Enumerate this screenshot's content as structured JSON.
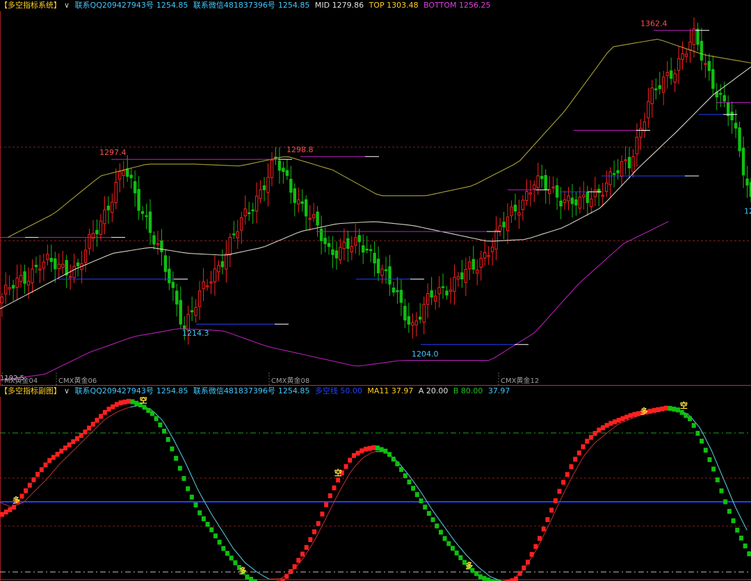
{
  "main": {
    "header": {
      "title": "【多空指标系统】",
      "dropdown": "∨",
      "qq": "联系QQ209427943号",
      "qq_value": "1254.85",
      "wechat": "联系微信481837396号",
      "wechat_value": "1254.85",
      "mid": "MID 1279.86",
      "top": "TOP 1303.48",
      "bottom": "BOTTOM 1256.25"
    },
    "price_labels": {
      "high1": "1297.4",
      "high2": "1298.8",
      "high3": "1362.4",
      "low1": "1214.3",
      "low2": "1204.0",
      "left_cut": "1192.5",
      "right_cut": "12"
    },
    "contract_labels": [
      "MX黄金04",
      "CMX黄金06",
      "CMX黄金08",
      "CMX黄金12"
    ]
  },
  "sub": {
    "header": {
      "title": "【多空指标副图】",
      "dropdown": "∨",
      "qq": "联系QQ209427943号",
      "qq_value": "1254.85",
      "wechat": "联系微信481837396号",
      "wechat_value": "1254.85",
      "line_label": "多空线 50.00",
      "ma": "MA11 37.97",
      "a": "A 20.00",
      "b": "B 80.00",
      "last": "37.97"
    },
    "signals": [
      {
        "text": "多",
        "x": 4
      },
      {
        "text": "空",
        "x": 36
      },
      {
        "text": "多",
        "x": 61
      },
      {
        "text": "空",
        "x": 85
      },
      {
        "text": "多",
        "x": 118
      },
      {
        "text": "多",
        "x": 162
      },
      {
        "text": "空",
        "x": 172
      }
    ]
  },
  "colors": {
    "up": "#ff2020",
    "down": "#10c010",
    "mid": "#e0e0d0",
    "top": "#c8c040",
    "bottom": "#c020c0",
    "ref_blue": "#2040ff",
    "header_cyan": "#40c8ff",
    "header_yellow": "#ffd020"
  },
  "chart_data": [
    {
      "type": "candlestick",
      "price_range": [
        1185,
        1370
      ],
      "candle_count": 198,
      "pivots": [
        [
          0,
          1228
        ],
        [
          10,
          1245
        ],
        [
          20,
          1242
        ],
        [
          32,
          1292
        ],
        [
          38,
          1268
        ],
        [
          48,
          1214
        ],
        [
          58,
          1248
        ],
        [
          72,
          1296
        ],
        [
          86,
          1252
        ],
        [
          96,
          1254
        ],
        [
          108,
          1214
        ],
        [
          114,
          1230
        ],
        [
          124,
          1242
        ],
        [
          140,
          1286
        ],
        [
          152,
          1274
        ],
        [
          165,
          1296
        ],
        [
          170,
          1326
        ],
        [
          182,
          1358
        ],
        [
          192,
          1316
        ],
        [
          197,
          1278
        ]
      ],
      "series": [
        {
          "name": "MID",
          "values": [
            1222,
            1232,
            1242,
            1250,
            1253,
            1250,
            1249,
            1253,
            1261,
            1265,
            1266,
            1264,
            1260,
            1256,
            1257,
            1263,
            1273,
            1293,
            1311,
            1330,
            1344
          ]
        },
        {
          "name": "TOP",
          "values": [
            1258,
            1270,
            1289,
            1295,
            1295,
            1294,
            1299,
            1292,
            1279,
            1279,
            1284,
            1296,
            1322,
            1354,
            1358,
            1350,
            1346
          ]
        },
        {
          "name": "BOTTOM",
          "values": [
            1186,
            1189,
            1200,
            1208,
            1212,
            1211,
            1203,
            1198,
            1193,
            1196,
            1196,
            1196,
            1210,
            1235,
            1255,
            1266
          ]
        }
      ]
    },
    {
      "type": "line",
      "ylim": [
        0,
        100
      ],
      "reference_lines": [
        20,
        50,
        80
      ],
      "series": [
        {
          "name": "多空线",
          "values": [
            45,
            48,
            55,
            62,
            68,
            72,
            76,
            80,
            85,
            90,
            93,
            94,
            92,
            88,
            80,
            68,
            55,
            45,
            38,
            30,
            24,
            18,
            15,
            14,
            16,
            22,
            30,
            40,
            52,
            62,
            70,
            73,
            74,
            72,
            66,
            58,
            50,
            42,
            34,
            28,
            22,
            18,
            16,
            15,
            17,
            24,
            34,
            46,
            58,
            68,
            76,
            81,
            84,
            86,
            88,
            89,
            90,
            91,
            90,
            86,
            76,
            64,
            50,
            38,
            28
          ]
        },
        {
          "name": "MA11",
          "values": [
            50,
            48,
            50,
            55,
            60,
            66,
            71,
            76,
            81,
            86,
            89,
            91,
            92,
            90,
            85,
            76,
            66,
            55,
            46,
            38,
            30,
            24,
            20,
            17,
            17,
            20,
            26,
            34,
            44,
            54,
            63,
            69,
            72,
            72,
            68,
            62,
            55,
            47,
            40,
            33,
            27,
            22,
            18,
            16,
            17,
            22,
            30,
            40,
            51,
            61,
            70,
            76,
            80,
            84,
            86,
            88,
            89,
            90,
            90,
            88,
            82,
            72,
            60,
            48,
            38
          ]
        }
      ]
    }
  ]
}
